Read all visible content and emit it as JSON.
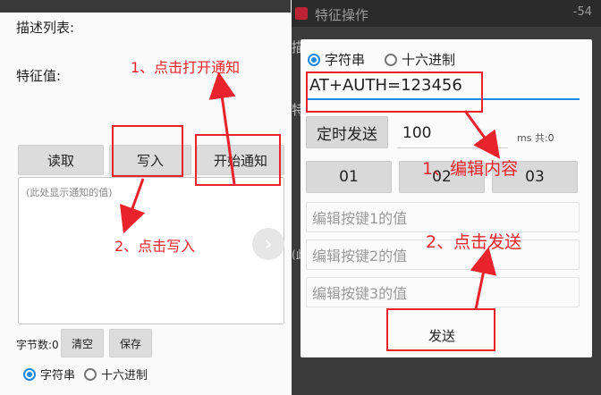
{
  "left": {
    "desc_list_label": "描述列表:",
    "char_value_label": "特征值:",
    "read_button": "读取",
    "write_button": "写入",
    "notify_button": "开始通知",
    "notify_placeholder": "(此处显示通知的值)",
    "byte_count_label": "字节数:0",
    "clear_button": "清空",
    "save_button": "保存",
    "radio_string": "字符串",
    "radio_hex": "十六进制"
  },
  "right": {
    "header_title": "特征操作",
    "header_rssi": "-54",
    "behind_label_1": "描述列表",
    "behind_label_2": "特",
    "behind_label_3": "(此",
    "radio_string": "字符串",
    "radio_hex": "十六进制",
    "input_value": "AT+AUTH=123456",
    "timer_send_button": "定时发送",
    "timer_value": "100",
    "timer_unit": "ms 共:0",
    "key_1": "01",
    "key_2": "02",
    "key_3": "03",
    "key_1_placeholder": "编辑按键1的值",
    "key_2_placeholder": "编辑按键2的值",
    "key_3_placeholder": "编辑按键3的值",
    "send_button": "发送"
  },
  "annotations": {
    "step1_left": "1、点击打开通知",
    "step2_left": "2、点击写入",
    "step1_right": "1、编辑内容",
    "step2_right": "2、点击发送",
    "color": "#e8232b"
  }
}
